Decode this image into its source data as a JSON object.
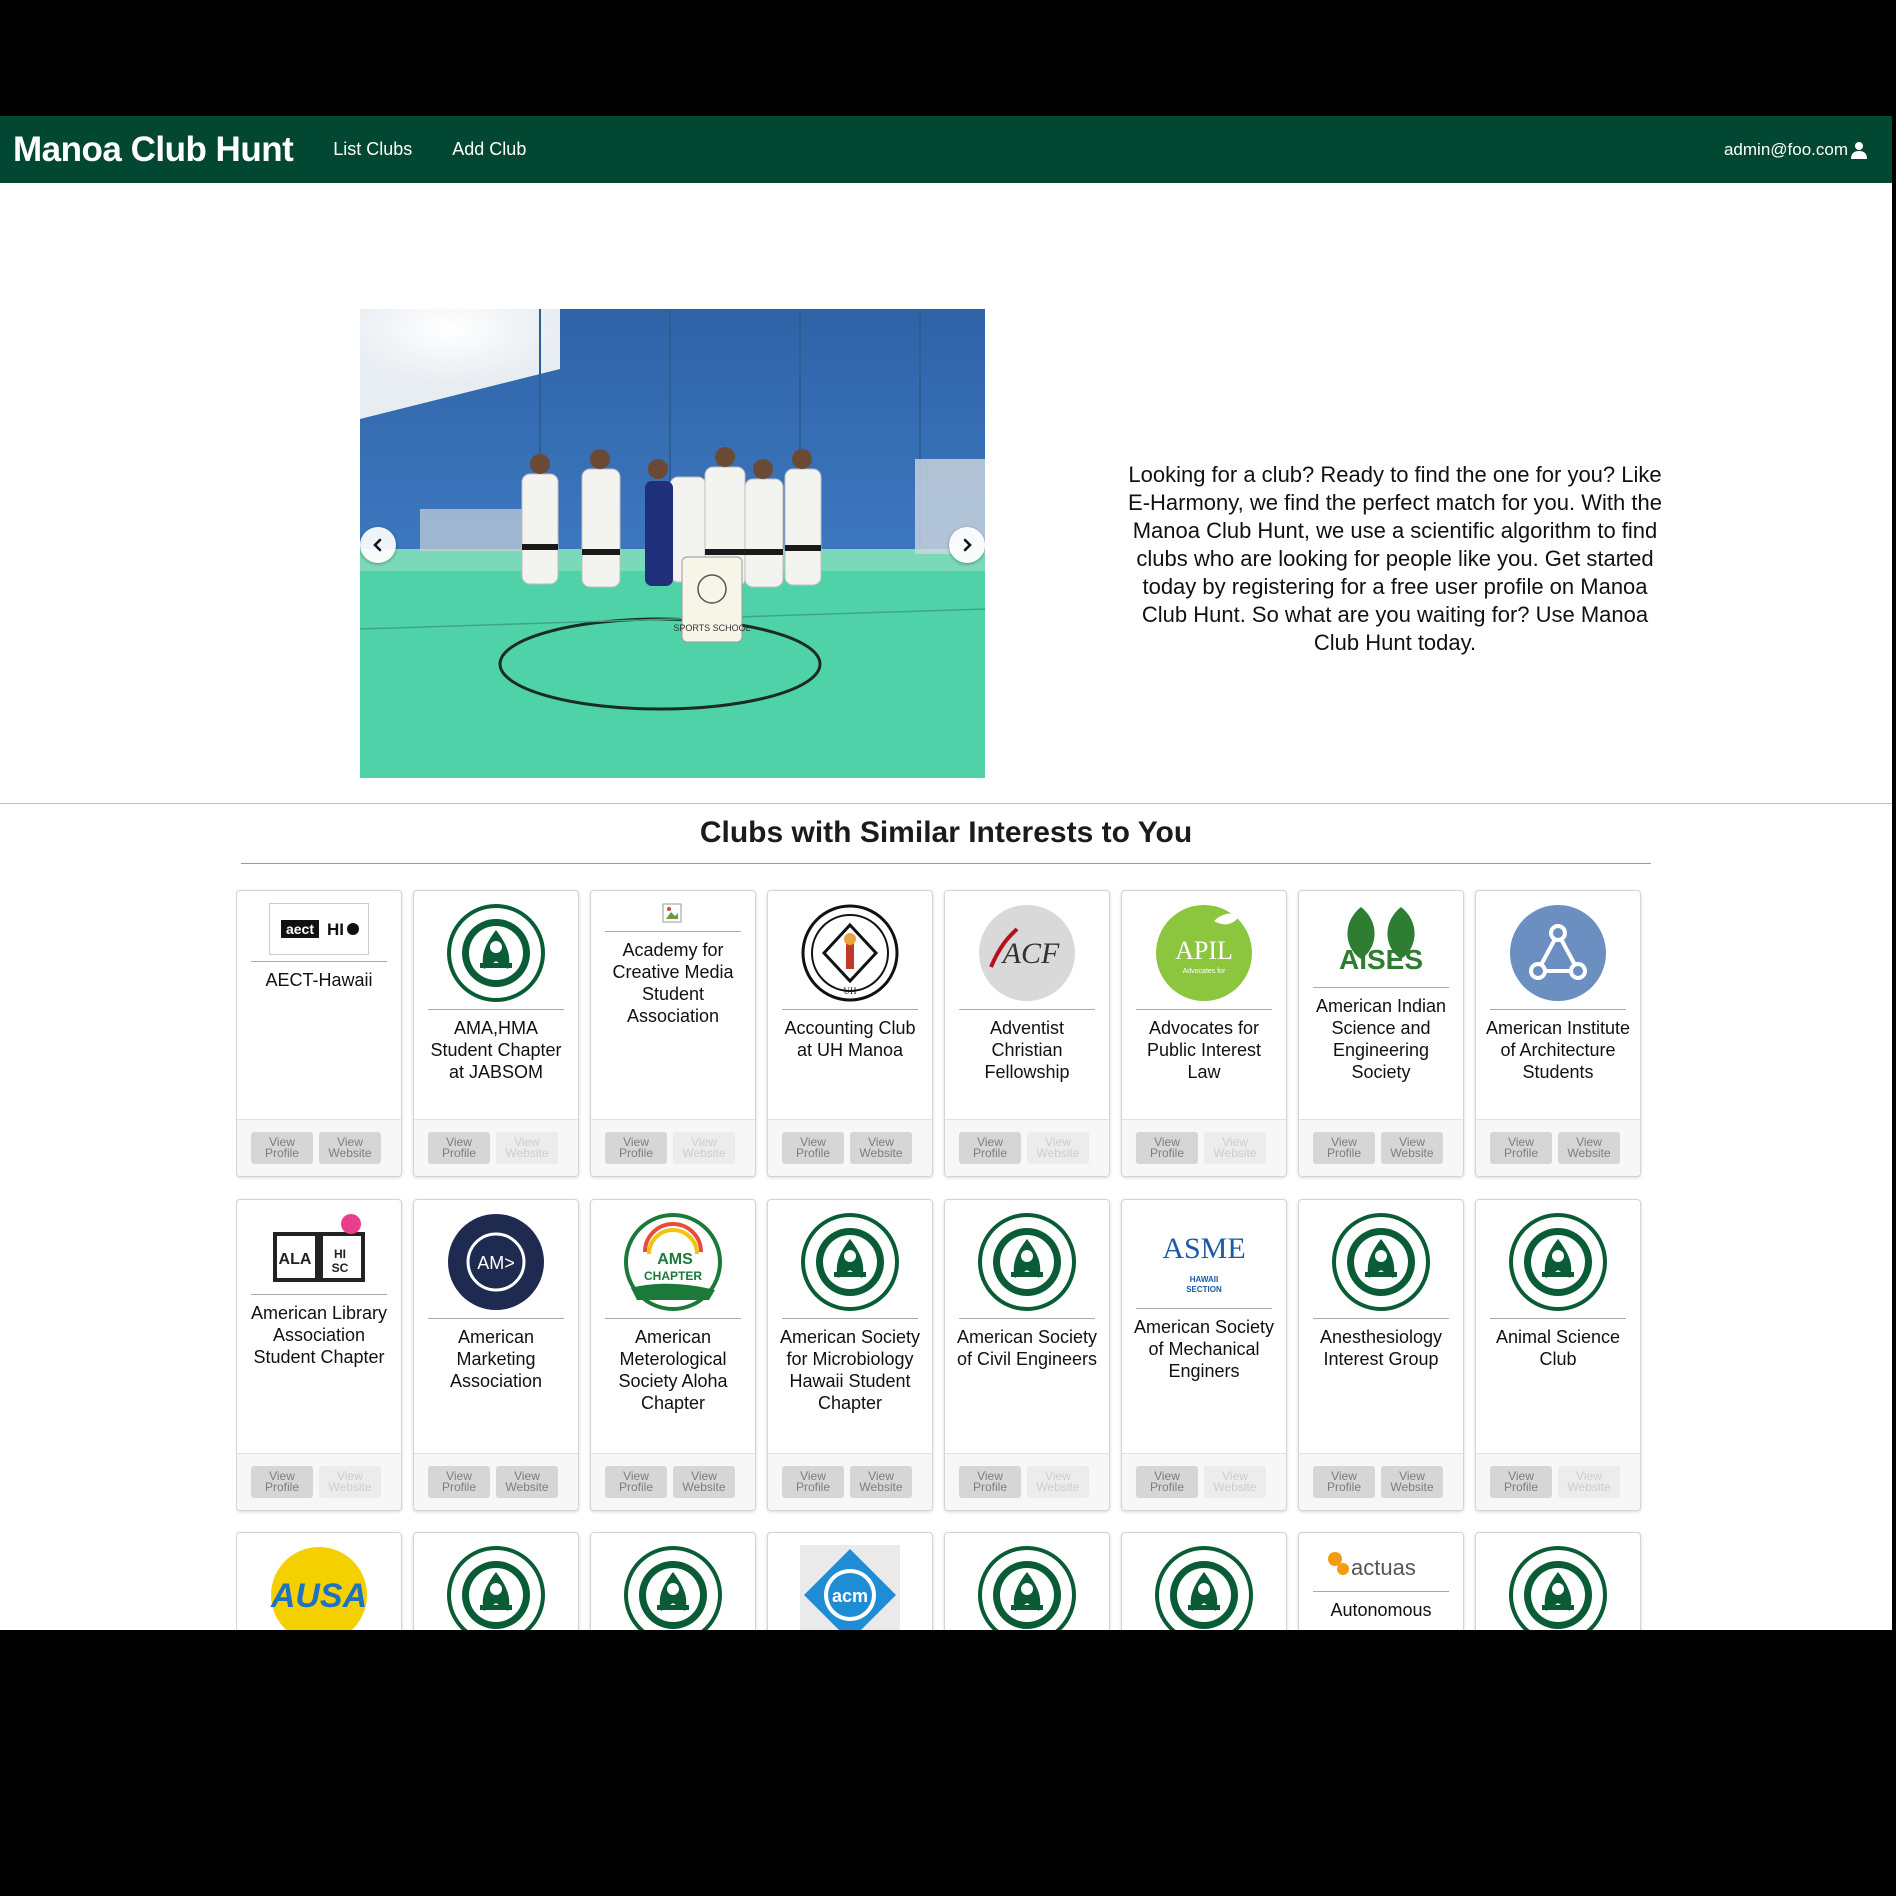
{
  "nav": {
    "brand": "Manoa Club Hunt",
    "links": [
      "List Clubs",
      "Add Club"
    ],
    "user": "admin@foo.com"
  },
  "hero": {
    "text": "Looking for a club? Ready to find the one for you? Like E-Harmony, we find the perfect match for you. With the Manoa Club Hunt, we use a scientific algorithm to find clubs who are looking for people like you. Get started today by registering for a free user profile on Manoa Club Hunt. So what are you waiting for? Use Manoa Club Hunt today.",
    "carousel": {
      "slide_count": 5,
      "active_index": 1
    },
    "photo_banner_text": "SPORTS SCHOOL"
  },
  "section": {
    "title": "Clubs with Similar Interests to You"
  },
  "buttons": {
    "profile": "View Profile",
    "website": "View Website"
  },
  "colors": {
    "nav_bg": "#024731",
    "uh_green": "#0a5c36"
  },
  "clubs": [
    {
      "name": "AECT-Hawaii",
      "logo": "aect-logo",
      "logo_text": "aectHI",
      "website_enabled": true
    },
    {
      "name": "AMA,HMA Student Chapter at JABSOM",
      "logo": "uh-seal-logo",
      "website_enabled": false
    },
    {
      "name": "Academy for Creative Media Student Association",
      "logo": "broken-image-icon",
      "website_enabled": false
    },
    {
      "name": "Accounting Club at UH Manoa",
      "logo": "accounting-club-logo",
      "logo_text": "ACCOUNTING CLUB UH",
      "website_enabled": true
    },
    {
      "name": "Adventist Christian Fellowship",
      "logo": "acf-logo",
      "logo_text": "ACF",
      "website_enabled": false
    },
    {
      "name": "Advocates for Public Interest Law",
      "logo": "apil-logo",
      "logo_text": "APIL",
      "website_enabled": false
    },
    {
      "name": "American Indian Science and Engineering Society",
      "logo": "aises-logo",
      "logo_text": "AISES",
      "website_enabled": true
    },
    {
      "name": "American Institute of Architecture Students",
      "logo": "aias-logo",
      "website_enabled": true
    },
    {
      "name": "American Library Association Student Chapter",
      "logo": "ala-logo",
      "logo_text": "ALA",
      "website_enabled": false
    },
    {
      "name": "American Marketing Association",
      "logo": "ama-logo",
      "logo_text": "AM>",
      "website_enabled": true
    },
    {
      "name": "American Meterological Society Aloha Chapter",
      "logo": "ams-aloha-logo",
      "logo_text": "AMS ALOHA CHAPTER",
      "website_enabled": true
    },
    {
      "name": "American Society for Microbiology Hawaii Student Chapter",
      "logo": "uh-seal-logo",
      "website_enabled": true
    },
    {
      "name": "American Society of Civil Engineers",
      "logo": "uh-seal-logo",
      "website_enabled": false
    },
    {
      "name": "American Society of Mechanical Enginers",
      "logo": "asme-logo",
      "logo_text": "ASME",
      "website_enabled": false
    },
    {
      "name": "Anesthesiology Interest Group",
      "logo": "uh-seal-logo",
      "website_enabled": true
    },
    {
      "name": "Animal Science Club",
      "logo": "uh-seal-logo",
      "website_enabled": false
    },
    {
      "name": "",
      "logo": "ausa-logo",
      "logo_text": "AUSA",
      "website_enabled": true
    },
    {
      "name": "",
      "logo": "uh-seal-logo",
      "website_enabled": true
    },
    {
      "name": "",
      "logo": "uh-seal-logo",
      "website_enabled": true
    },
    {
      "name": "",
      "logo": "acm-logo",
      "logo_text": "acm",
      "website_enabled": true
    },
    {
      "name": "",
      "logo": "uh-seal-logo",
      "website_enabled": true
    },
    {
      "name": "",
      "logo": "uh-seal-logo",
      "website_enabled": true
    },
    {
      "name": "Autonomous",
      "logo": "actuas-logo",
      "logo_text": "actuas",
      "website_enabled": true
    },
    {
      "name": "",
      "logo": "uh-seal-logo",
      "website_enabled": true
    }
  ]
}
